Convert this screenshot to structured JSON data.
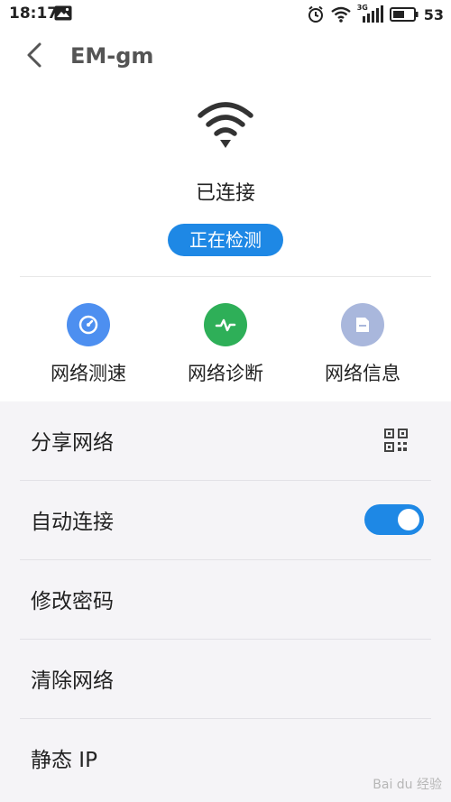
{
  "status_bar": {
    "time": "18:17",
    "network_type": "3G",
    "battery": "53"
  },
  "header": {
    "title": "EM-gm"
  },
  "connection": {
    "status": "已连接",
    "detect_button": "正在检测"
  },
  "tools": [
    {
      "label": "网络测速",
      "icon": "speedometer-icon",
      "color": "#4d8ff0"
    },
    {
      "label": "网络诊断",
      "icon": "pulse-icon",
      "color": "#2eaf58"
    },
    {
      "label": "网络信息",
      "icon": "document-icon",
      "color": "#a9b7dc"
    }
  ],
  "settings": [
    {
      "label": "分享网络",
      "icon": "qr-code-icon"
    },
    {
      "label": "自动连接",
      "toggle_on": true
    },
    {
      "label": "修改密码"
    },
    {
      "label": "清除网络"
    },
    {
      "label": "静态 IP"
    }
  ],
  "watermark": "Bai du 经验",
  "colors": {
    "accent": "#1e88e5",
    "background": "#ffffff",
    "list_background": "#f5f4f7"
  }
}
